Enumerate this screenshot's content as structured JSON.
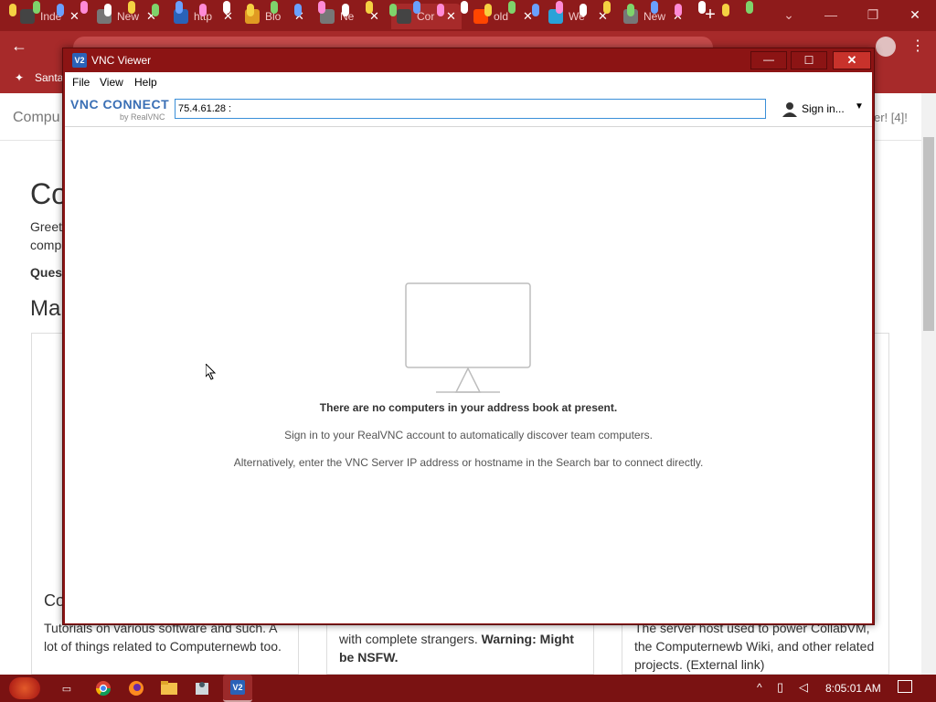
{
  "browser": {
    "tabs": [
      {
        "label": "Inde",
        "fav_color": "#444444",
        "fav_glyph": "person-icon"
      },
      {
        "label": "New",
        "fav_color": "#777777",
        "fav_glyph": "chrome-icon"
      },
      {
        "label": "http",
        "fav_color": "#2a62b8",
        "fav_glyph": "vnc-icon"
      },
      {
        "label": "Blo",
        "fav_color": "#e09a22",
        "fav_glyph": "blogger-icon"
      },
      {
        "label": "Ne",
        "fav_color": "#777777",
        "fav_glyph": "chrome-icon"
      },
      {
        "label": "Cor",
        "fav_color": "#444444",
        "fav_glyph": "person-icon",
        "active": true
      },
      {
        "label": "old",
        "fav_color": "#ff4500",
        "fav_glyph": "reddit-icon"
      },
      {
        "label": "We",
        "fav_color": "#2aa2d8",
        "fav_glyph": "bird-icon"
      },
      {
        "label": "New Ta",
        "fav_color": "#777777",
        "fav_glyph": "chrome-icon"
      }
    ],
    "bookmark_label": "Santa"
  },
  "page": {
    "header_left": "Compu",
    "header_right": "er! [4]!",
    "heading1": "Co",
    "greeting_line1": "Greet",
    "greeting_line2": "comp",
    "question": "Ques",
    "heading2": "Ma",
    "card1_title": "Co",
    "card1_text_line1": "Tutorials on various software and such. A",
    "card1_text_line2": "lot of things related to Computernewb too.",
    "card2_text_line1": "with complete strangers.",
    "card2_warning": "Warning: Might",
    "card2_warning_line2": "be NSFW.",
    "card3_text_line1": "The server host used to power CollabVM,",
    "card3_text_line2": "the Computernewb Wiki, and other related",
    "card3_text_line3": "projects. (External link)"
  },
  "vnc": {
    "title": "VNC Viewer",
    "menu": [
      "File",
      "View",
      "Help"
    ],
    "logo_line1": "VNC CONNECT",
    "logo_line2": "by RealVNC",
    "address_value": "75.4.61.28 :",
    "sign_in_label": "Sign in...",
    "empty_title": "There are no computers in your address book at present.",
    "empty_line1": "Sign in to your RealVNC account to automatically discover team computers.",
    "empty_line2": "Alternatively, enter the VNC Server IP address or hostname in the Search bar to connect directly."
  },
  "taskbar": {
    "clock": "8:05:01 AM"
  },
  "colors": {
    "chrome_theme": "#a72a2a",
    "vnc_frame": "#8c1414",
    "address_border": "#3a8fd8",
    "close_button": "#c8322b"
  }
}
